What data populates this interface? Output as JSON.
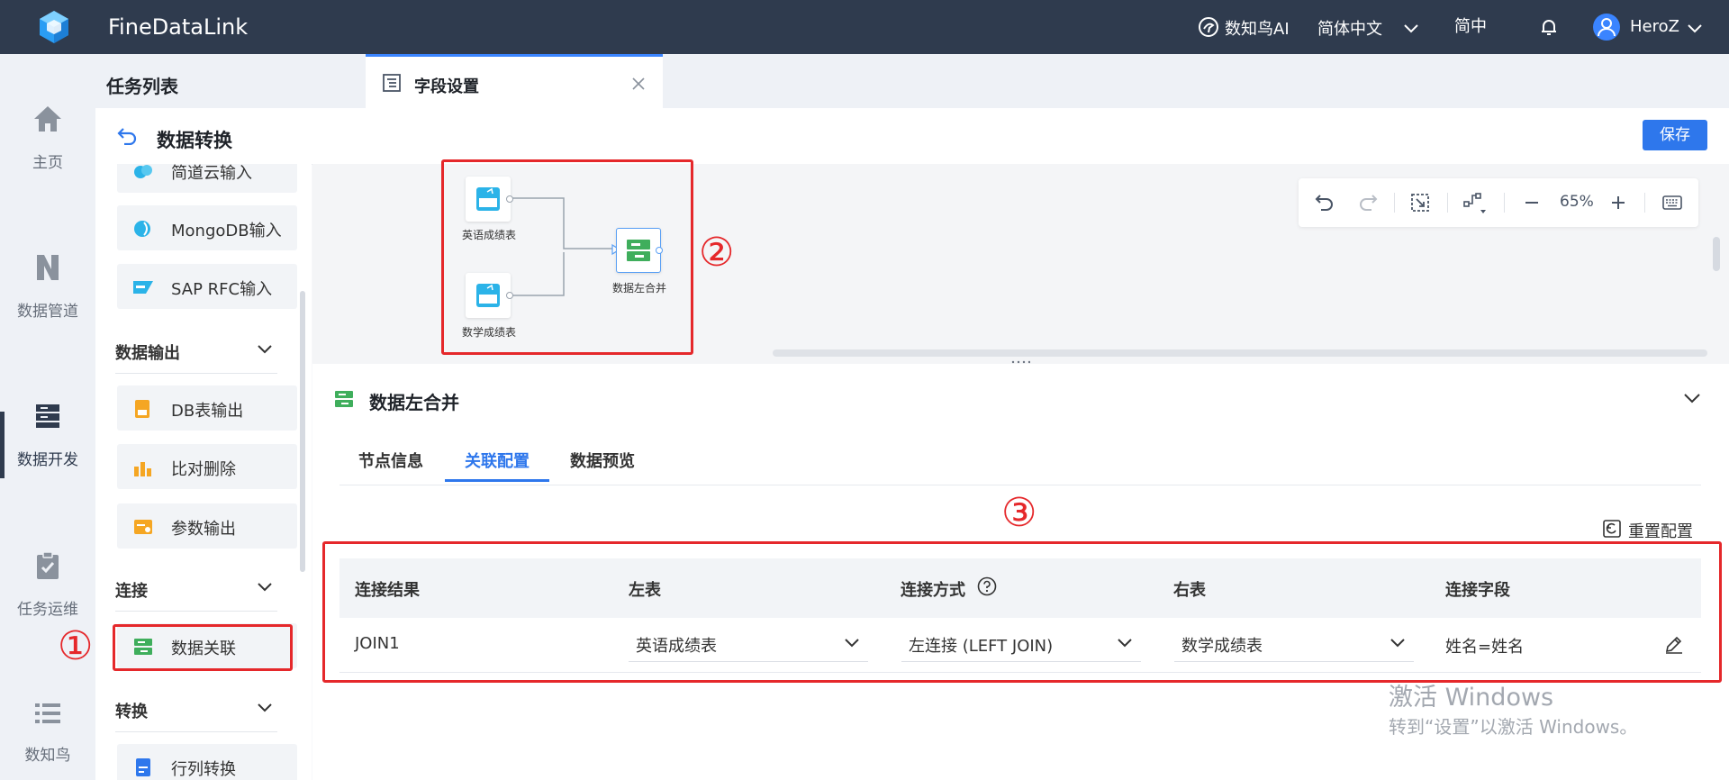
{
  "topbar": {
    "app_title": "FineDataLink",
    "ai_label": "数知鸟AI",
    "language": "简体中文",
    "simplified": "简中",
    "user": "HeroZ"
  },
  "leftnav": {
    "items": [
      {
        "label": "主页",
        "icon": "home-icon"
      },
      {
        "label": "数据管道",
        "icon": "pipeline-icon"
      },
      {
        "label": "数据开发",
        "icon": "data-dev-icon",
        "active": true
      },
      {
        "label": "任务运维",
        "icon": "task-ops-icon"
      },
      {
        "label": "数知鸟",
        "icon": "list-icon"
      }
    ]
  },
  "tabs": {
    "task_list": "任务列表",
    "field_settings": "字段设置"
  },
  "header": {
    "title": "数据转换",
    "save": "保存"
  },
  "components": {
    "items_top": [
      {
        "label": "简道云输入",
        "icon": "jiandaoyun-icon"
      },
      {
        "label": "MongoDB输入",
        "icon": "mongodb-icon"
      },
      {
        "label": "SAP RFC输入",
        "icon": "sap-icon"
      }
    ],
    "group_output": "数据输出",
    "items_output": [
      {
        "label": "DB表输出",
        "icon": "db-output-icon"
      },
      {
        "label": "比对删除",
        "icon": "compare-delete-icon"
      },
      {
        "label": "参数输出",
        "icon": "param-output-icon"
      }
    ],
    "group_join": "连接",
    "item_join": {
      "label": "数据关联",
      "icon": "data-join-icon"
    },
    "group_transform": "转换",
    "item_transform": {
      "label": "行列转换",
      "icon": "row-col-icon"
    }
  },
  "canvas": {
    "zoom": "65%",
    "nodes": [
      {
        "label": "英语成绩表",
        "icon": "db-icon"
      },
      {
        "label": "数学成绩表",
        "icon": "db-icon"
      },
      {
        "label": "数据左合并",
        "icon": "merge-icon"
      }
    ]
  },
  "config": {
    "title": "数据左合并",
    "tabs": [
      "节点信息",
      "关联配置",
      "数据预览"
    ],
    "active_tab": "关联配置",
    "reset": "重置配置",
    "columns": [
      "连接结果",
      "左表",
      "连接方式",
      "右表",
      "连接字段"
    ],
    "row": {
      "result": "JOIN1",
      "left_table": "英语成绩表",
      "join_type": "左连接 (LEFT JOIN)",
      "right_table": "数学成绩表",
      "join_field": "姓名=姓名"
    }
  },
  "annotations": [
    "①",
    "②",
    "③"
  ],
  "watermark": {
    "line1": "激活 Windows",
    "line2": "转到“设置”以激活 Windows。"
  },
  "colors": {
    "topbar": "#2f3b4e",
    "accent": "#2e77ec",
    "annotation_red": "#e5282b"
  }
}
